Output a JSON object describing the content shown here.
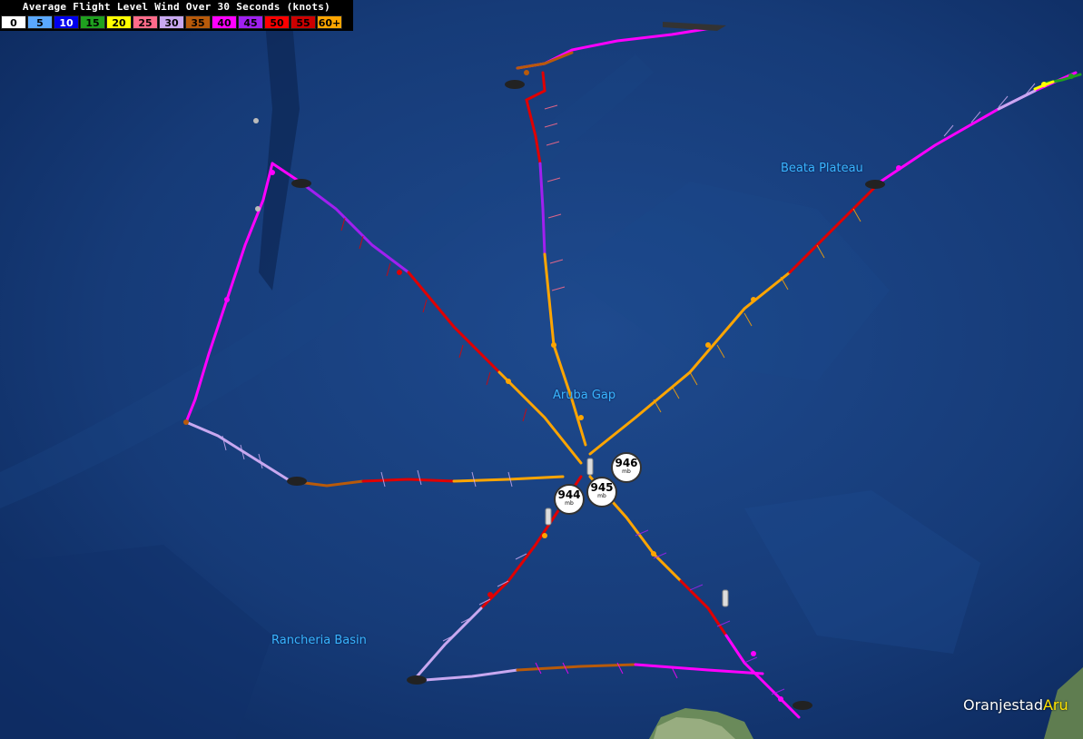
{
  "legend": {
    "title": "Average Flight Level Wind Over 30 Seconds (knots)",
    "bins": [
      {
        "label": "0",
        "color": "#ffffff",
        "text": "#000000"
      },
      {
        "label": "5",
        "color": "#5aa8ff",
        "text": "#000000"
      },
      {
        "label": "10",
        "color": "#0000ee",
        "text": "#ffffff"
      },
      {
        "label": "15",
        "color": "#1fa01f",
        "text": "#000000"
      },
      {
        "label": "20",
        "color": "#ffff00",
        "text": "#000000"
      },
      {
        "label": "25",
        "color": "#ff6b8a",
        "text": "#000000"
      },
      {
        "label": "30",
        "color": "#c8a8f0",
        "text": "#000000"
      },
      {
        "label": "35",
        "color": "#b85a0a",
        "text": "#000000"
      },
      {
        "label": "40",
        "color": "#ff00ff",
        "text": "#000000"
      },
      {
        "label": "45",
        "color": "#a020f0",
        "text": "#000000"
      },
      {
        "label": "50",
        "color": "#ff0000",
        "text": "#000000"
      },
      {
        "label": "55",
        "color": "#cc0000",
        "text": "#000000"
      },
      {
        "label": "60+",
        "color": "#ffa500",
        "text": "#000000"
      }
    ]
  },
  "places": {
    "beata": "Beata Plateau",
    "aruba_gap": "Aruba Gap",
    "rancheria": "Rancheria Basin",
    "oranjestad": "Oranjestad",
    "oranjestad_cut": "Aru"
  },
  "pressures": [
    {
      "value": "946",
      "unit": "mb"
    },
    {
      "value": "945",
      "unit": "mb"
    },
    {
      "value": "944",
      "unit": "mb"
    }
  ],
  "colors": {
    "ocean": "#173d7a",
    "track_orange": "#ffa500",
    "track_red": "#e00000",
    "track_magenta": "#ff00ff",
    "track_purple": "#a020f0",
    "track_lavender": "#c8a8f0",
    "track_brown": "#b85a0a"
  }
}
